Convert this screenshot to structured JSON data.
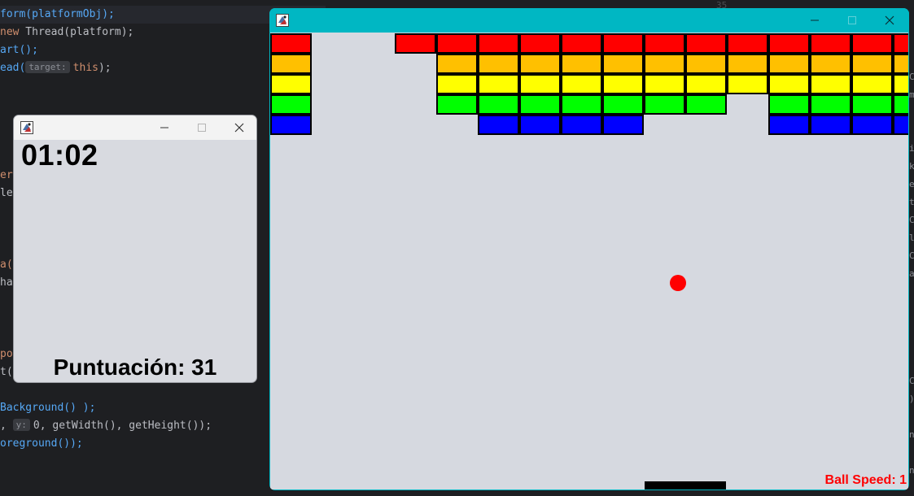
{
  "ide": {
    "code_lines": [
      [
        {
          "t": "form(platformObj);",
          "c": "tok-fn"
        }
      ],
      [
        {
          "t": "new",
          "c": "tok-kw"
        },
        {
          "t": " Thread(platform);",
          "c": "tok-punc"
        }
      ],
      [
        {
          "t": "art();",
          "c": "tok-fn"
        }
      ],
      [
        {
          "t": "ead(",
          "c": "tok-fn"
        },
        {
          "t": "target:",
          "c": "tok-hint"
        },
        {
          "t": "this",
          "c": "tok-kw"
        },
        {
          "t": ");",
          "c": "tok-punc"
        }
      ],
      [
        {
          "t": "Background() );",
          "c": "tok-fn"
        }
      ],
      [
        {
          "t": ", ",
          "c": "tok-punc"
        },
        {
          "t": "y:",
          "c": "tok-hint"
        },
        {
          "t": "0, getWidth(), getHeight());",
          "c": "tok-punc"
        }
      ],
      [
        {
          "t": "oreground());",
          "c": "tok-fn"
        }
      ]
    ],
    "fragments": [
      {
        "text": "er",
        "color": "#cf8e6d"
      },
      {
        "text": "ler",
        "color": "#bcbec4"
      },
      {
        "text": "a(",
        "color": "#cf8e6d"
      },
      {
        "text": "ha",
        "color": "#bcbec4"
      },
      {
        "text": "po",
        "color": "#cf8e6d"
      },
      {
        "text": "t(",
        "color": "#bcbec4"
      }
    ],
    "gutter_number": "35",
    "right_strip": [
      "C",
      "m",
      "i",
      "k",
      "e",
      "t",
      "C",
      "l",
      "C",
      "a",
      "C",
      ")",
      "n",
      "n"
    ]
  },
  "score_window": {
    "timer": "01:02",
    "score_label": "Puntuación: 31"
  },
  "game_window": {
    "speed_label": "Ball Speed: 1",
    "colors": {
      "titlebar": "#00b7c3",
      "background": "#d6d9e0",
      "ball": "#ff0000",
      "paddle": "#000000"
    },
    "brick_rows": [
      {
        "color": "#ff0000",
        "present": [
          1,
          0,
          0,
          1,
          1,
          1,
          1,
          1,
          1,
          1,
          1,
          1,
          1,
          1,
          1,
          1
        ]
      },
      {
        "color": "#ffc000",
        "present": [
          1,
          0,
          0,
          0,
          1,
          1,
          1,
          1,
          1,
          1,
          1,
          1,
          1,
          1,
          1,
          1
        ]
      },
      {
        "color": "#ffff00",
        "present": [
          1,
          0,
          0,
          0,
          1,
          1,
          1,
          1,
          1,
          1,
          1,
          1,
          1,
          1,
          1,
          1
        ]
      },
      {
        "color": "#00ff00",
        "present": [
          1,
          0,
          0,
          0,
          1,
          1,
          1,
          1,
          1,
          1,
          1,
          0,
          1,
          1,
          1,
          1
        ]
      },
      {
        "color": "#0000ff",
        "present": [
          1,
          0,
          0,
          0,
          0,
          1,
          1,
          1,
          1,
          0,
          0,
          0,
          1,
          1,
          1,
          1
        ]
      }
    ]
  }
}
